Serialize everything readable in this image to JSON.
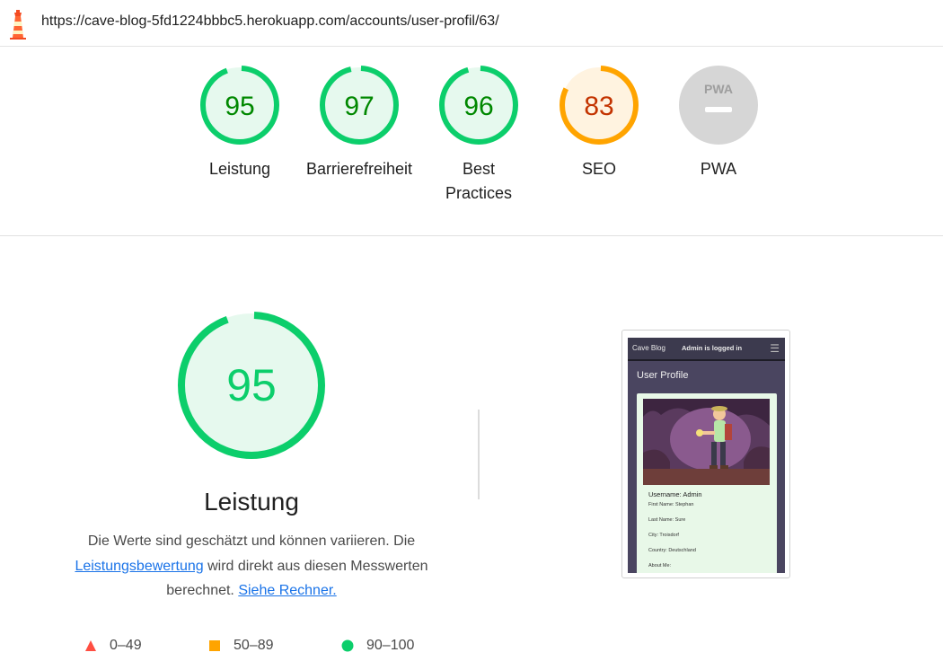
{
  "browser": {
    "url": "https://cave-blog-5fd1224bbbc5.herokuapp.com/accounts/user-profil/63/"
  },
  "gauges": [
    {
      "score": "95",
      "label": "Leistung",
      "fraction": 0.95,
      "status": "pass"
    },
    {
      "score": "97",
      "label": "Barrierefreiheit",
      "fraction": 0.97,
      "status": "pass"
    },
    {
      "score": "96",
      "label": "Best Practices",
      "fraction": 0.96,
      "status": "pass"
    },
    {
      "score": "83",
      "label": "SEO",
      "fraction": 0.83,
      "status": "average"
    },
    {
      "score": "",
      "label": "PWA",
      "badge": "PWA",
      "status": "na"
    }
  ],
  "performance": {
    "score": "95",
    "fraction": 0.95,
    "title": "Leistung",
    "desc_part1": "Die Werte sind geschätzt und können variieren. Die",
    "link1": "Leistungsbewertung",
    "desc_part2": "wird direkt aus diesen Messwerten berechnet.",
    "link2": "Siehe Rechner."
  },
  "legend": {
    "fail": "0–49",
    "average": "50–89",
    "pass": "90–100"
  },
  "colors": {
    "pass": "#0cce6b",
    "pass_text": "#008800",
    "pass_bg": "#e6f9ee",
    "average": "#ffa400",
    "average_text": "#c33300",
    "average_bg": "#fff3e0",
    "fail": "#ff4e42",
    "na": "#d6d6d6"
  },
  "screenshot": {
    "brand": "Cave Blog",
    "status": "Admin is logged in",
    "title": "User Profile",
    "username": "Username: Admin",
    "rows": [
      "First Name: Stephan",
      "Last Name: Sure",
      "City: Troisdorf",
      "Country: Deutschland",
      "About Me:"
    ]
  }
}
